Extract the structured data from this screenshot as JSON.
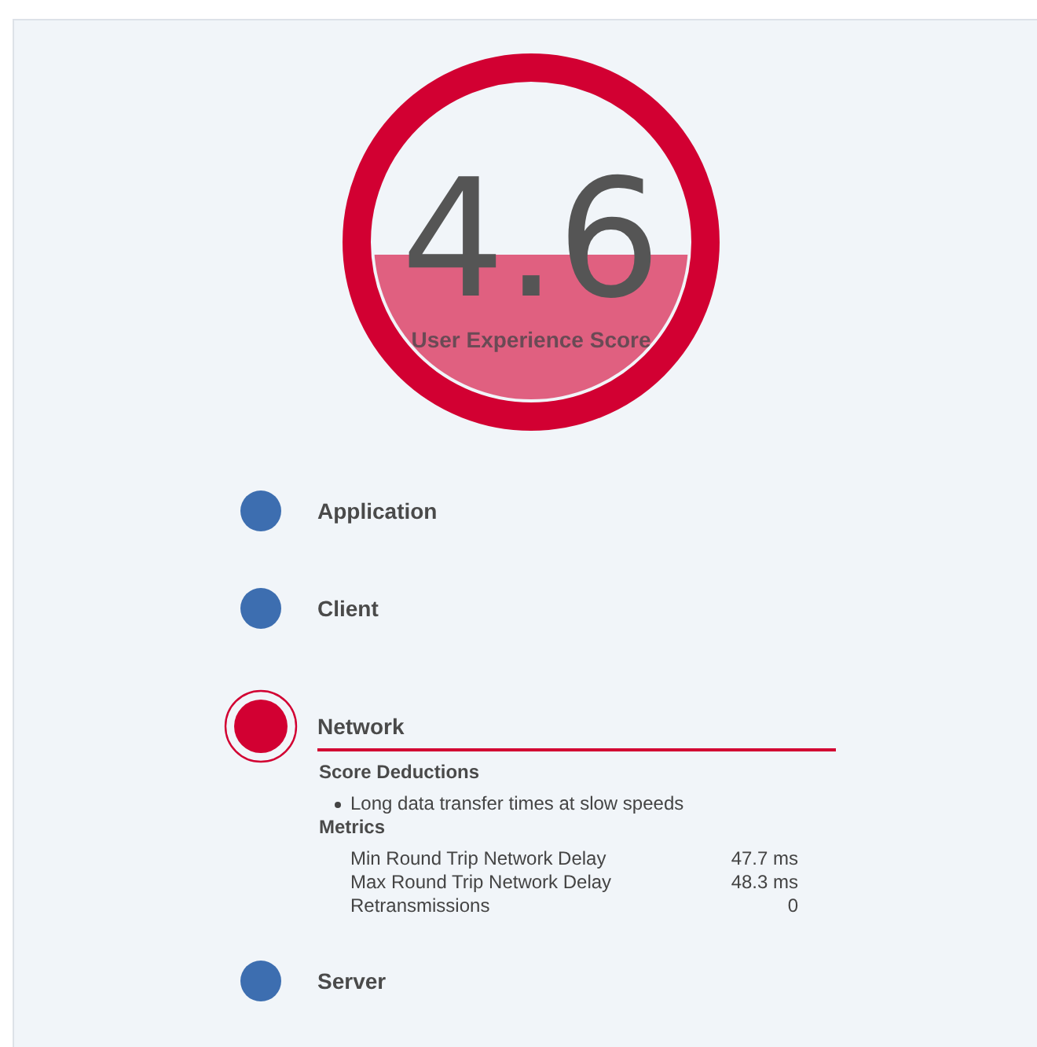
{
  "score": {
    "value": "4.6",
    "label": "User Experience Score"
  },
  "components": [
    {
      "name": "Application",
      "color": "#3d6eb0",
      "selected": false,
      "expanded": false
    },
    {
      "name": "Client",
      "color": "#3d6eb0",
      "selected": false,
      "expanded": false
    },
    {
      "name": "Network",
      "color": "#d20032",
      "selected": true,
      "expanded": true,
      "details": {
        "deductions_title": "Score Deductions",
        "deductions": [
          "Long data transfer times at slow speeds"
        ],
        "metrics_title": "Metrics",
        "metrics": [
          {
            "label": "Min Round Trip Network Delay",
            "value": "47.7 ms"
          },
          {
            "label": "Max Round Trip Network Delay",
            "value": "48.3 ms"
          },
          {
            "label": "Retransmissions",
            "value": "0"
          }
        ]
      }
    },
    {
      "name": "Server",
      "color": "#3d6eb0",
      "selected": false,
      "expanded": false
    }
  ]
}
